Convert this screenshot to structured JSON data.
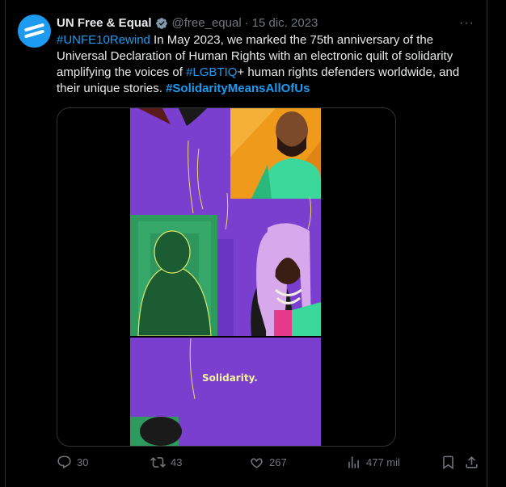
{
  "author": {
    "name": "UN Free & Equal",
    "handle": "@free_equal",
    "separator": "·",
    "date": "15 dic. 2023"
  },
  "tweet": {
    "hashtag1": "#UNFE10Rewind",
    "text1": " In May 2023, we marked the 75th anniversary of the Universal Declaration of Human Rights with an electronic quilt of solidarity amplifying the voices of ",
    "hashtag2": "#LGBTIQ",
    "text2": "+ human rights defenders worldwide, and their unique stories. ",
    "hashtag3": "#SolidarityMeansAllOfUs"
  },
  "media": {
    "caption": "Solidarity."
  },
  "actions": {
    "replies": "30",
    "reposts": "43",
    "likes": "267",
    "views": "477 mil"
  },
  "colors": {
    "accent": "#1d9bf0",
    "purple": "#7b3fd0",
    "teal": "#3bd89b",
    "orange": "#f09a1c",
    "green": "#2a8a56"
  }
}
